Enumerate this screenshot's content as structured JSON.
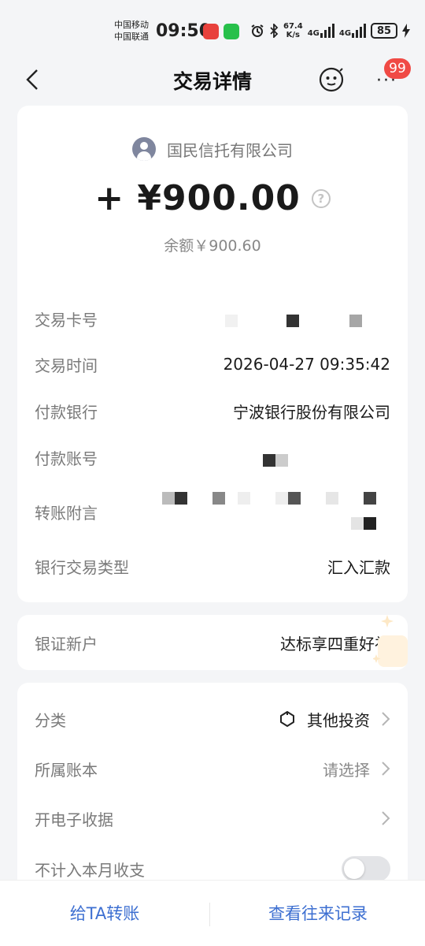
{
  "status_bar": {
    "carrier_1": "中国移动",
    "carrier_2": "中国联通",
    "time": "09:50",
    "net_speed": "67.4",
    "net_unit": "K/s",
    "net_type_1": "4G",
    "net_type_2": "4G",
    "battery": "85"
  },
  "header": {
    "title": "交易详情",
    "badge": "99"
  },
  "transaction": {
    "payee": "国民信托有限公司",
    "amount": "+ ¥900.00",
    "help": "?",
    "balance": "余额￥900.60",
    "rows": [
      {
        "label": "交易卡号",
        "value": ""
      },
      {
        "label": "交易时间",
        "value": "2026-04-27 09:35:42"
      },
      {
        "label": "付款银行",
        "value": "宁波银行股份有限公司"
      },
      {
        "label": "付款账号",
        "value": ""
      },
      {
        "label": "转账附言",
        "value": ""
      },
      {
        "label": "银行交易类型",
        "value": "汇入汇款"
      }
    ]
  },
  "promo": {
    "label": "银证新户",
    "value": "达标享四重好礼"
  },
  "details": {
    "category_label": "分类",
    "category_value": "其他投资",
    "account_label": "所属账本",
    "account_value": "请选择",
    "receipt_label": "开电子收据",
    "exclude_label": "不计入本月收支",
    "exclude_on": false
  },
  "bottom_bar": {
    "transfer": "给TA转账",
    "history": "查看往来记录"
  },
  "colors": {
    "accent": "#3d6fd1",
    "badge": "#f04a45",
    "background": "#f4f5f7"
  }
}
